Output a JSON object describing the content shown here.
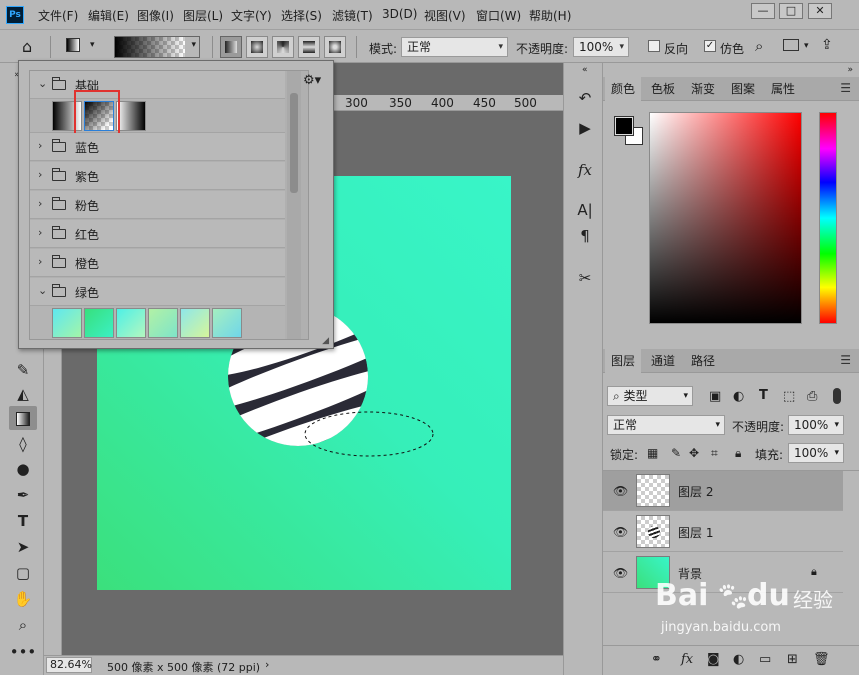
{
  "app": {
    "logo": "Ps"
  },
  "menu": [
    "文件(F)",
    "编辑(E)",
    "图像(I)",
    "图层(L)",
    "文字(Y)",
    "选择(S)",
    "滤镜(T)",
    "3D(D)",
    "视图(V)",
    "窗口(W)",
    "帮助(H)"
  ],
  "window_controls": {
    "minimize": "—",
    "maximize": "□",
    "close": "✕"
  },
  "options": {
    "mode_label": "模式:",
    "mode_value": "正常",
    "opacity_label": "不透明度:",
    "opacity_value": "100%",
    "reverse_label": "反向",
    "reverse_checked": false,
    "dither_label": "仿色",
    "dither_checked": true
  },
  "ruler": {
    "ticks": [
      "300",
      "350",
      "400",
      "450",
      "500"
    ]
  },
  "status": {
    "zoom": "82.64%",
    "doc_info": "500 像素 x 500 像素 (72 ppi)"
  },
  "gradient_popup": {
    "groups": [
      {
        "label": "基础",
        "expanded": true
      },
      {
        "label": "蓝色",
        "expanded": false
      },
      {
        "label": "紫色",
        "expanded": false
      },
      {
        "label": "粉色",
        "expanded": false
      },
      {
        "label": "红色",
        "expanded": false
      },
      {
        "label": "橙色",
        "expanded": false
      },
      {
        "label": "绿色",
        "expanded": true
      }
    ],
    "basic_swatches": [
      "foreground-to-background",
      "foreground-to-transparent",
      "black-to-white"
    ],
    "selected_swatch": "foreground-to-transparent",
    "highlight_color": "#e0322f"
  },
  "color_panel": {
    "tabs": [
      "颜色",
      "色板",
      "渐变",
      "图案",
      "属性"
    ],
    "active_tab": "颜色",
    "foreground": "#000000",
    "background": "#ffffff"
  },
  "layers_panel": {
    "tabs": [
      "图层",
      "通道",
      "路径"
    ],
    "active_tab": "图层",
    "filter_value": "类型",
    "blend_mode": "正常",
    "opacity_label": "不透明度:",
    "opacity_value": "100%",
    "lock_label": "锁定:",
    "fill_label": "填充:",
    "fill_value": "100%",
    "layers": [
      {
        "name": "图层 2",
        "selected": true
      },
      {
        "name": "图层 1",
        "selected": false
      },
      {
        "name": "背景",
        "selected": false,
        "locked": true
      }
    ]
  },
  "canvas": {
    "gradient_start": "#3be07c",
    "gradient_end": "#38f5c8"
  },
  "watermark": {
    "brand": "Bai",
    "brand2": "du",
    "site": "经验",
    "url": "jingyan.baidu.com"
  }
}
